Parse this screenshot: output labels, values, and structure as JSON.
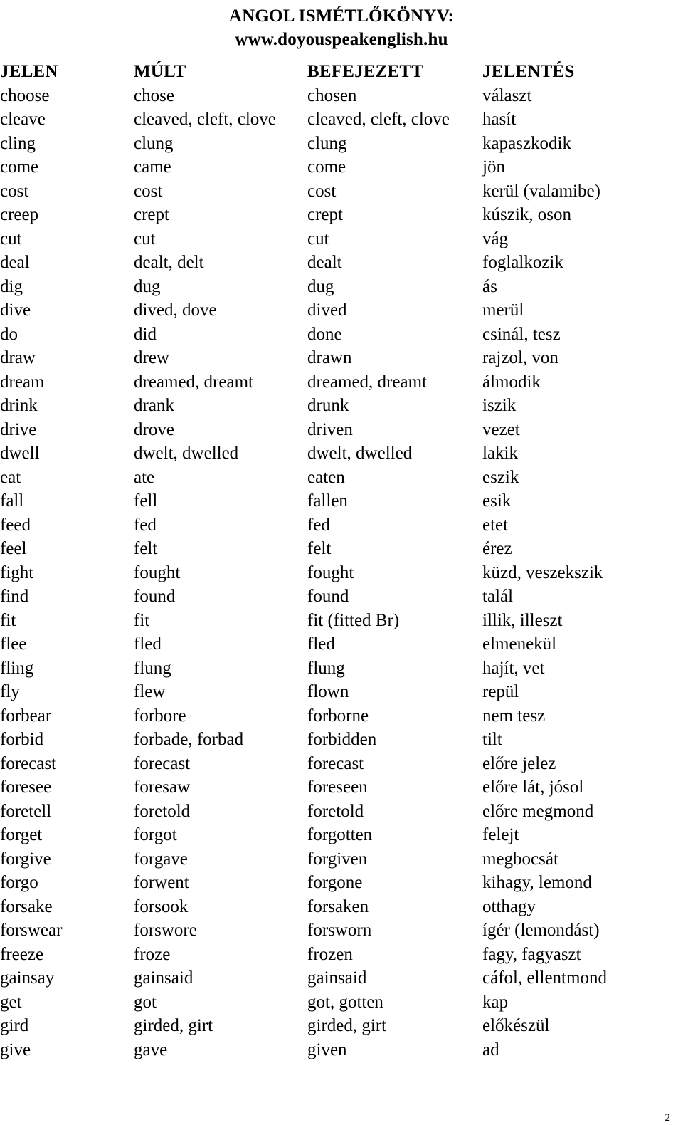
{
  "document": {
    "title_lines": [
      "ANGOL ISMÉTLŐKÖNYV:",
      "www.doyouspeakenglish.hu"
    ],
    "page_number": "2"
  },
  "table": {
    "headers": [
      "JELEN",
      "MÚLT",
      "BEFEJEZETT",
      "JELENTÉS"
    ],
    "rows": [
      [
        "choose",
        "chose",
        "chosen",
        "választ"
      ],
      [
        "cleave",
        "cleaved, cleft, clove",
        "cleaved, cleft, clove",
        "hasít"
      ],
      [
        "cling",
        "clung",
        "clung",
        "kapaszkodik"
      ],
      [
        "come",
        "came",
        "come",
        "jön"
      ],
      [
        "cost",
        "cost",
        "cost",
        "kerül (valamibe)"
      ],
      [
        "creep",
        "crept",
        "crept",
        "kúszik, oson"
      ],
      [
        "cut",
        "cut",
        "cut",
        "vág"
      ],
      [
        "deal",
        "dealt, delt",
        "dealt",
        "foglalkozik"
      ],
      [
        "dig",
        "dug",
        "dug",
        "ás"
      ],
      [
        "dive",
        "dived, dove",
        "dived",
        "merül"
      ],
      [
        "do",
        "did",
        "done",
        "csinál, tesz"
      ],
      [
        "draw",
        "drew",
        "drawn",
        "rajzol, von"
      ],
      [
        "dream",
        "dreamed, dreamt",
        "dreamed, dreamt",
        "álmodik"
      ],
      [
        "drink",
        "drank",
        "drunk",
        "iszik"
      ],
      [
        "drive",
        "drove",
        "driven",
        "vezet"
      ],
      [
        "dwell",
        "dwelt, dwelled",
        "dwelt, dwelled",
        "lakik"
      ],
      [
        "eat",
        "ate",
        "eaten",
        "eszik"
      ],
      [
        "fall",
        "fell",
        "fallen",
        "esik"
      ],
      [
        "feed",
        "fed",
        "fed",
        "etet"
      ],
      [
        "feel",
        "felt",
        "felt",
        "érez"
      ],
      [
        "fight",
        "fought",
        "fought",
        "küzd, veszekszik"
      ],
      [
        "find",
        "found",
        "found",
        "talál"
      ],
      [
        "fit",
        "fit",
        "fit (fitted Br)",
        "illik, illeszt"
      ],
      [
        "flee",
        "fled",
        "fled",
        "elmenekül"
      ],
      [
        "fling",
        "flung",
        "flung",
        "hajít, vet"
      ],
      [
        "fly",
        "flew",
        "flown",
        "repül"
      ],
      [
        "forbear",
        "forbore",
        "forborne",
        "nem tesz"
      ],
      [
        "forbid",
        "forbade, forbad",
        "forbidden",
        "tilt"
      ],
      [
        "forecast",
        "forecast",
        "forecast",
        "előre jelez"
      ],
      [
        "foresee",
        "foresaw",
        "foreseen",
        "előre lát, jósol"
      ],
      [
        "foretell",
        "foretold",
        "foretold",
        "előre megmond"
      ],
      [
        "forget",
        "forgot",
        "forgotten",
        "felejt"
      ],
      [
        "forgive",
        "forgave",
        "forgiven",
        "megbocsát"
      ],
      [
        "forgo",
        "forwent",
        "forgone",
        "kihagy, lemond"
      ],
      [
        "forsake",
        "forsook",
        "forsaken",
        "otthagy"
      ],
      [
        "forswear",
        "forswore",
        "forsworn",
        "ígér (lemondást)"
      ],
      [
        "freeze",
        "froze",
        "frozen",
        "fagy, fagyaszt"
      ],
      [
        "gainsay",
        "gainsaid",
        "gainsaid",
        "cáfol, ellentmond"
      ],
      [
        "get",
        "got",
        "got, gotten",
        "kap"
      ],
      [
        "gird",
        "girded, girt",
        "girded, girt",
        "előkészül"
      ],
      [
        "give",
        "gave",
        "given",
        "ad"
      ]
    ]
  }
}
